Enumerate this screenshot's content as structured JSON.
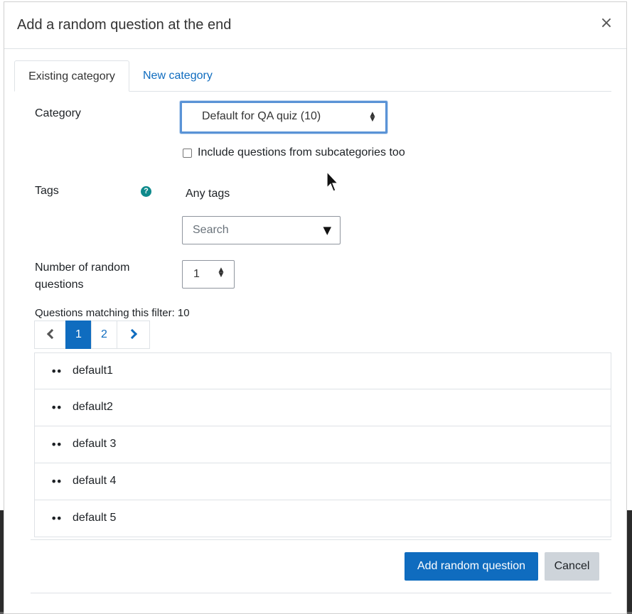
{
  "modal": {
    "title": "Add a random question at the end",
    "close_symbol": "×"
  },
  "tabs": [
    {
      "label": "Existing category",
      "active": true
    },
    {
      "label": "New category",
      "active": false
    }
  ],
  "form": {
    "category_label": "Category",
    "category_value": "Default for QA quiz (10)",
    "include_subcategories_label": "Include questions from subcategories too",
    "include_subcategories_checked": false,
    "tags_label": "Tags",
    "tags_help_symbol": "?",
    "tags_current": "Any tags",
    "tags_search_placeholder": "Search",
    "number_label_line1": "Number of random",
    "number_label_line2": "questions",
    "number_value": "1"
  },
  "filter": {
    "matching_text": "Questions matching this filter: 10"
  },
  "pagination": {
    "pages": [
      "1",
      "2"
    ],
    "current": "1"
  },
  "questions": [
    {
      "name": "default1"
    },
    {
      "name": "default2"
    },
    {
      "name": "default 3"
    },
    {
      "name": "default 4"
    },
    {
      "name": "default 5"
    }
  ],
  "footer": {
    "primary_label": "Add random question",
    "cancel_label": "Cancel"
  },
  "colors": {
    "primary": "#0f6cbf",
    "help": "#0e8a8c",
    "focus": "#5a93d6"
  }
}
